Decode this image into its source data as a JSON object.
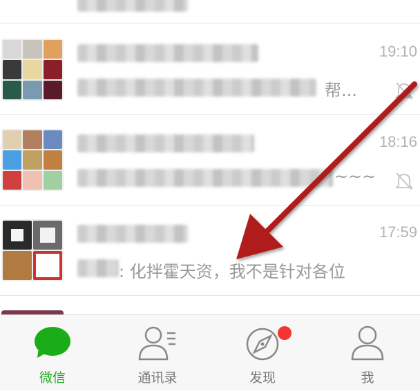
{
  "chats": [
    {
      "time": "19:10",
      "preview_suffix": "帮...",
      "muted": true
    },
    {
      "time": "18:16",
      "preview_suffix": "~~~",
      "muted": true
    },
    {
      "time": "17:59",
      "preview_suffix": ": 化拌霍天资，我不是针对各位",
      "muted": false
    }
  ],
  "tabbar": {
    "tabs": [
      {
        "label": "微信",
        "icon": "chat-bubble-icon",
        "active": true
      },
      {
        "label": "通讯录",
        "icon": "contacts-icon",
        "active": false
      },
      {
        "label": "发现",
        "icon": "compass-icon",
        "active": false,
        "badge": true
      },
      {
        "label": "我",
        "icon": "person-icon",
        "active": false
      }
    ]
  },
  "colors": {
    "accent_green": "#1aad19",
    "badge_red": "#f43530",
    "annotation_arrow": "#b01c1c"
  }
}
